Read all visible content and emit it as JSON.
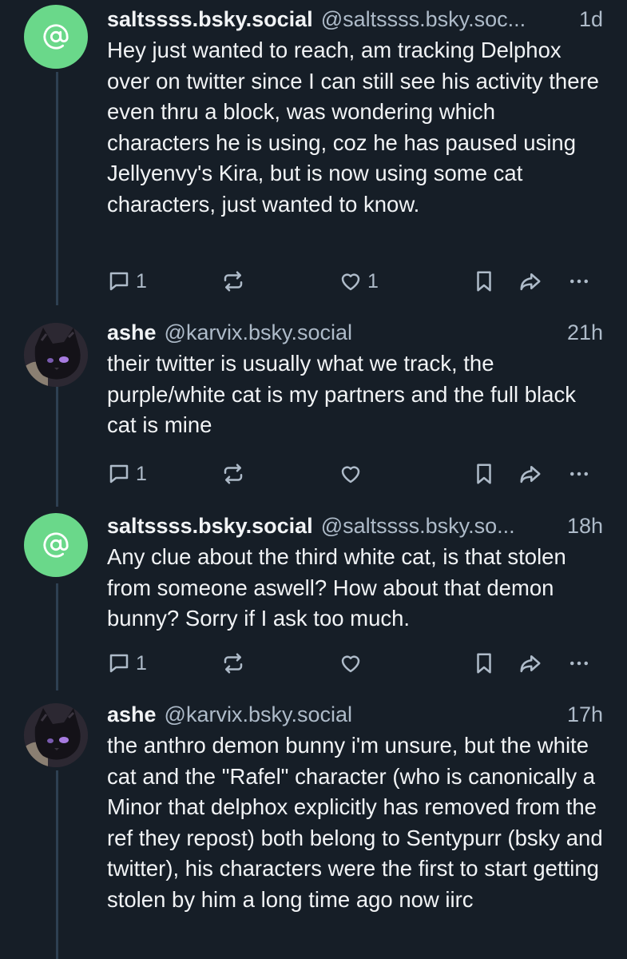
{
  "thread": {
    "posts": [
      {
        "display_name": "saltssss.bsky.social",
        "handle": "@saltssss.bsky.soc...",
        "time": "1d",
        "avatar_icon": "at-sign-icon",
        "text": "Hey just wanted to reach, am tracking Delphox over on twitter since I can still see his activity there even thru a block, was wondering which characters he is using, coz he has paused using Jellyenvy's Kira, but is now using some cat characters, just wanted to know.",
        "reply_count": "1",
        "repost_count": "",
        "like_count": "1"
      },
      {
        "display_name": "ashe",
        "handle": "@karvix.bsky.social",
        "time": "21h",
        "avatar_icon": "cat-avatar",
        "text": "their twitter is usually what we track, the purple/white cat is my partners and the full black cat is mine",
        "reply_count": "1",
        "repost_count": "",
        "like_count": ""
      },
      {
        "display_name": "saltssss.bsky.social",
        "handle": "@saltssss.bsky.so...",
        "time": "18h",
        "avatar_icon": "at-sign-icon",
        "text": "Any clue about the third white cat, is that stolen from someone aswell? How about that demon bunny? Sorry if I ask too much.",
        "reply_count": "1",
        "repost_count": "",
        "like_count": ""
      },
      {
        "display_name": "ashe",
        "handle": "@karvix.bsky.social",
        "time": "17h",
        "avatar_icon": "cat-avatar",
        "text": "the anthro demon bunny i'm unsure, but the white cat and the \"Rafel\" character (who is canonically a Minor that delphox explicitly has removed from the ref they repost) both belong to Sentypurr (bsky and twitter), his characters were the first to start getting stolen by him a long time ago now iirc"
      }
    ]
  },
  "colors": {
    "background": "#161e27",
    "thread_line": "#2e4052",
    "text_primary": "#f1f3f5",
    "text_secondary": "#aebbc9",
    "default_avatar": "#6ad88a"
  }
}
